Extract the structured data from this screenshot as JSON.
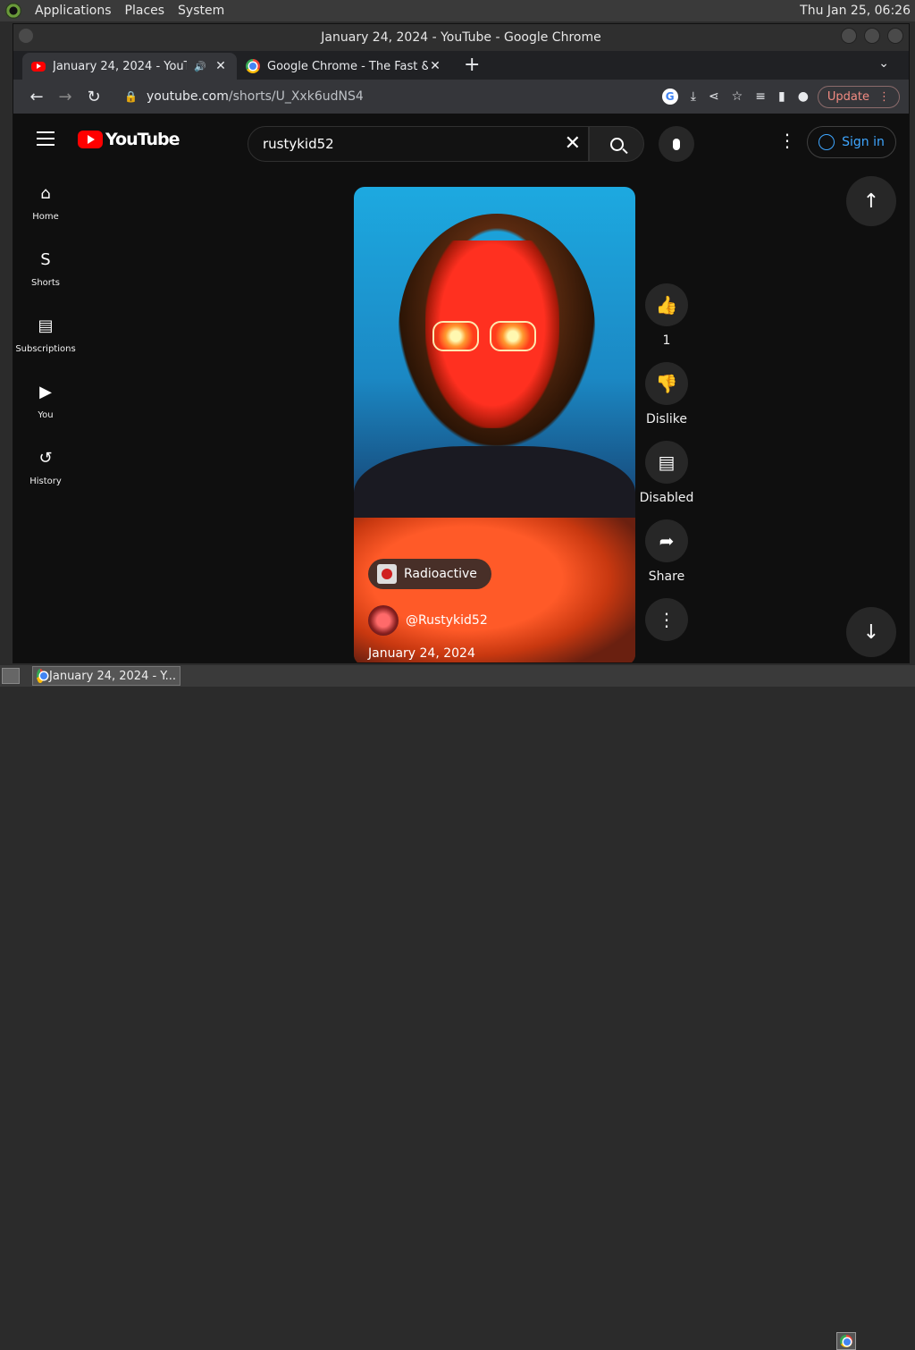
{
  "top_panel": {
    "menus": [
      "Applications",
      "Places",
      "System"
    ],
    "clock": "Thu Jan 25, 06:26"
  },
  "window": {
    "title": "January 24, 2024 - YouTube - Google Chrome"
  },
  "tabs": [
    {
      "title": "January 24, 2024 - YouTube",
      "icon": "youtube-favicon",
      "audio": true
    },
    {
      "title": "Google Chrome - The Fast & Secure",
      "icon": "chrome-favicon"
    }
  ],
  "toolbar": {
    "url_host": "youtube.com",
    "url_path": "/shorts/U_Xxk6udNS4",
    "update_label": "Update"
  },
  "youtube": {
    "logo_text": "YouTube",
    "search_value": "rustykid52",
    "signin_label": "Sign in",
    "sidebar": [
      {
        "label": "Home",
        "icon": "home-icon"
      },
      {
        "label": "Shorts",
        "icon": "shorts-icon"
      },
      {
        "label": "Subscriptions",
        "icon": "subscriptions-icon"
      },
      {
        "label": "You",
        "icon": "you-icon"
      },
      {
        "label": "History",
        "icon": "history-icon"
      }
    ],
    "short": {
      "sound": "Radioactive",
      "channel": "@Rustykid52",
      "date": "January 24, 2024"
    },
    "actions": {
      "like_count": "1",
      "dislike_label": "Dislike",
      "comments_label": "Disabled",
      "share_label": "Share"
    }
  },
  "taskbar": {
    "item_title": "January 24, 2024 - Y..."
  },
  "colors": {
    "yt_red": "#ff0000",
    "link_blue": "#3ea6ff",
    "page_bg": "#0f0f0f"
  }
}
